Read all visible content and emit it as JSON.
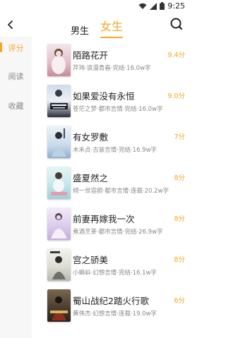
{
  "status": {
    "time": "9:25"
  },
  "tabs": {
    "male": "男生",
    "female": "女生"
  },
  "sidebar": [
    {
      "label": "评分",
      "active": true
    },
    {
      "label": "阅读",
      "active": false
    },
    {
      "label": "收藏",
      "active": false
    }
  ],
  "books": [
    {
      "title": "陌路花开",
      "author": "芹玮",
      "category": "浪漫青春",
      "status": "完结",
      "words": "16.0w字",
      "score": "9.4分",
      "cover_color": "#e9cfd6"
    },
    {
      "title": "如果爱没有永恒",
      "author": "苍茫之梦",
      "category": "都市言情",
      "status": "完结",
      "words": "16.0w字",
      "score": "9.0分",
      "cover_color": "#dfe6f0"
    },
    {
      "title": "有女罗敷",
      "author": "木禾贞",
      "category": "古装言情",
      "status": "完结",
      "words": "16.9w字",
      "score": "7分",
      "cover_color": "#dfe9f3"
    },
    {
      "title": "盛夏然之",
      "author": "倾一世容颜",
      "category": "都市言情",
      "status": "连载",
      "words": "20.2w字",
      "score": "8分",
      "cover_color": "#dff1f2"
    },
    {
      "title": "前妻再嫁我一次",
      "author": "煮酒烹茶",
      "category": "都市言情",
      "status": "完结",
      "words": "26.9w字",
      "score": "8分",
      "cover_color": "#eae2f2"
    },
    {
      "title": "宫之骄美",
      "author": "小蝌蚪",
      "category": "幻想言情",
      "status": "完结",
      "words": "16.1w字",
      "score": "8分",
      "cover_color": "#e8e8e4"
    },
    {
      "title": "蜀山战纪2踏火行歌",
      "author": "黄伟杰",
      "category": "幻想言情",
      "status": "连载",
      "words": "19.0w字",
      "score": "6分",
      "cover_color": "#5b4a3a"
    }
  ]
}
